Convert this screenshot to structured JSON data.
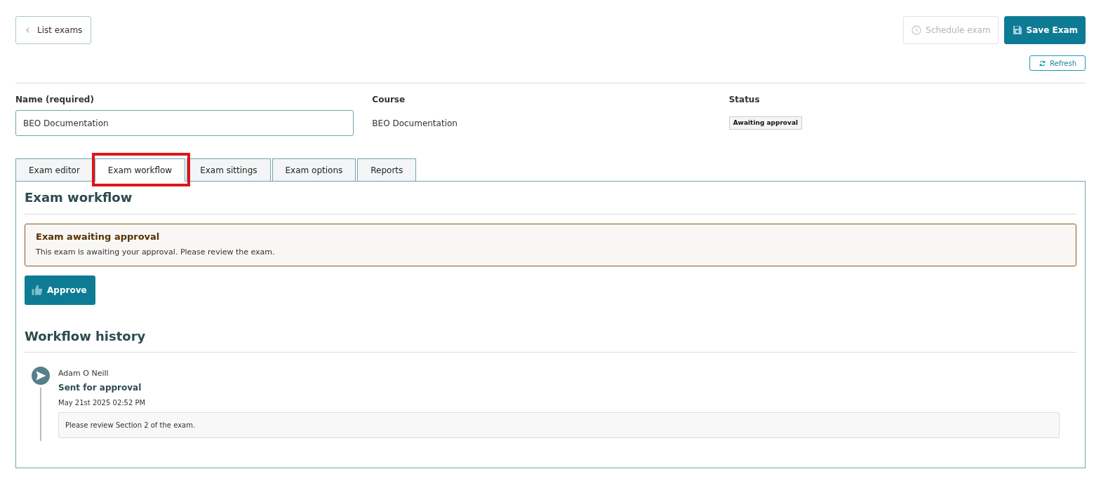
{
  "back_button": {
    "label": "List exams"
  },
  "actions": [
    {
      "label": "Schedule exam",
      "kind": "schedule",
      "disabled": true
    },
    {
      "label": "Save Exam",
      "kind": "save",
      "disabled": false
    }
  ],
  "refresh_button": {
    "label": "Refresh"
  },
  "fields": [
    {
      "label": "Name (required)",
      "kind": "input",
      "value": "BEO Documentation"
    },
    {
      "label": "Course",
      "kind": "text",
      "value": "BEO Documentation"
    },
    {
      "label": "Status",
      "kind": "badge",
      "value": "Awaiting approval"
    }
  ],
  "tabs": [
    {
      "label": "Exam editor",
      "selected": false,
      "highlighted": false
    },
    {
      "label": "Exam workflow",
      "selected": true,
      "highlighted": true
    },
    {
      "label": "Exam sittings",
      "selected": false,
      "highlighted": false
    },
    {
      "label": "Exam options",
      "selected": false,
      "highlighted": false
    },
    {
      "label": "Reports",
      "selected": false,
      "highlighted": false
    }
  ],
  "panel": {
    "title": "Exam workflow",
    "alert": {
      "title": "Exam awaiting approval",
      "text": "This exam is awaiting your approval. Please review the exam."
    },
    "approve_button": {
      "label": "Approve"
    },
    "history_title": "Workflow history",
    "history": [
      {
        "author": "Adam O Neill",
        "action": "Sent for approval",
        "date": "May 21st 2025 02:52 PM",
        "comment": "Please review Section 2 of the exam."
      }
    ]
  }
}
